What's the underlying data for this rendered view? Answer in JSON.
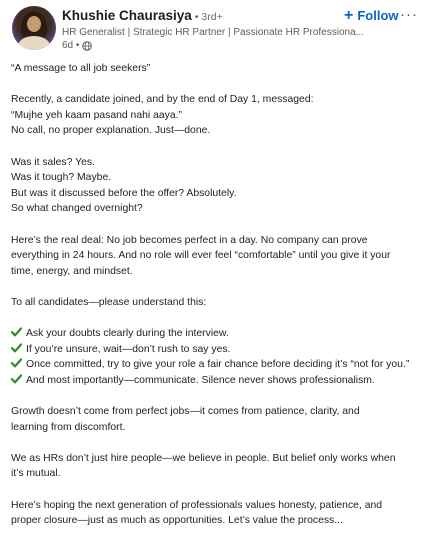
{
  "author": {
    "name": "Khushie Chaurasiya",
    "degree": "• 3rd+",
    "headline": "HR Generalist | Strategic HR Partner | Passionate HR Professiona...",
    "time": "6d •"
  },
  "follow_label": "Follow",
  "icons": {
    "globe": "globe-icon",
    "more": "more-icon",
    "plus": "plus-icon",
    "check": "check-icon"
  },
  "colors": {
    "accent": "#0a66c2",
    "check": "#2e8b2e"
  },
  "post": {
    "title": "“A message to all job seekers”",
    "p1": [
      "Recently, a candidate joined, and by the end of Day 1, messaged:",
      "“Mujhe yeh kaam pasand nahi aaya.”",
      "No call, no proper explanation. Just—done."
    ],
    "p2": [
      "Was it sales? Yes.",
      "Was it tough? Maybe.",
      "But was it discussed before the offer? Absolutely.",
      "So what changed overnight?"
    ],
    "p3": [
      "Here’s the real deal: No job becomes perfect in a day. No company can prove",
      "everything in 24 hours. And no role will ever feel “comfortable” until you give it your",
      "time, energy, and mindset."
    ],
    "p4": "To all candidates—please understand this:",
    "checks": [
      "Ask your doubts clearly during the interview.",
      "If you’re unsure, wait—don’t rush to say yes.",
      "Once committed, try to give your role a fair chance before deciding it’s “not for you.”",
      "And most importantly—communicate. Silence never shows professionalism."
    ],
    "p5": [
      "Growth doesn’t come from perfect jobs—it comes from patience, clarity, and",
      "learning from discomfort."
    ],
    "p6": [
      "We as HRs don’t just hire people—we believe in people. But belief only works when",
      "it’s mutual."
    ],
    "p7": [
      "Here’s hoping the next generation of professionals values honesty, patience, and",
      "proper closure—just as much as opportunities. Let’s value the process..."
    ]
  }
}
